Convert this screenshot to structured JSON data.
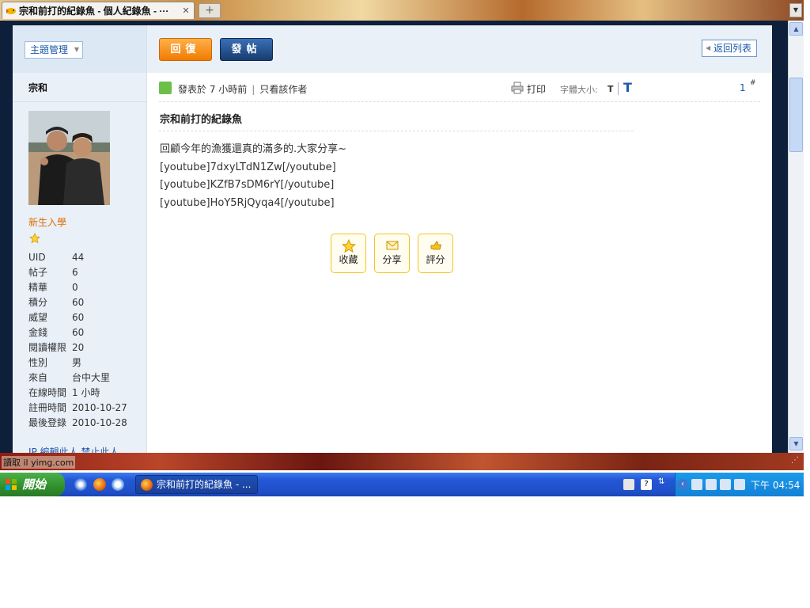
{
  "browser": {
    "tab_title": "宗和前打的紀錄魚 - 個人紀錄魚 - ···",
    "new_tab_symbol": "+",
    "status_text": "讀取 il yimg.com"
  },
  "toolbar": {
    "topic_management": "主題管理",
    "reply_label": "回復",
    "post_label": "發帖",
    "back_to_list": "返回列表"
  },
  "author": {
    "name": "宗和",
    "user_group": "新生入學",
    "stats": [
      {
        "label": "UID",
        "value": "44"
      },
      {
        "label": "帖子",
        "value": "6"
      },
      {
        "label": "精華",
        "value": "0"
      },
      {
        "label": "積分",
        "value": "60"
      },
      {
        "label": "威望",
        "value": "60"
      },
      {
        "label": "金錢",
        "value": "60"
      },
      {
        "label": "閱讀權限",
        "value": "20"
      },
      {
        "label": "性別",
        "value": "男"
      },
      {
        "label": "來自",
        "value": "台中大里"
      },
      {
        "label": "在線時間",
        "value": "1 小時"
      },
      {
        "label": "註冊時間",
        "value": "2010-10-27"
      },
      {
        "label": "最後登錄",
        "value": "2010-10-28"
      }
    ],
    "links": "IP   編輯此人   禁止此人"
  },
  "post": {
    "posted_at": "發表於 7 小時前",
    "separator": "|",
    "only_author": "只看該作者",
    "print_label": "打印",
    "font_size_label": "字體大小:",
    "font_small": "T",
    "font_large": "T",
    "floor_number": "1",
    "floor_symbol": "#",
    "title": "宗和前打的紀錄魚",
    "lines": [
      "回顧今年的漁獲還真的滿多的.大家分享~",
      "[youtube]7dxyLTdN1Zw[/youtube]",
      "[youtube]KZfB7sDM6rY[/youtube]",
      "[youtube]HoY5RjQyqa4[/youtube]"
    ],
    "actions": {
      "favorite": "收藏",
      "share": "分享",
      "rate": "評分"
    }
  },
  "taskbar": {
    "start_label": "開始",
    "window_button": "宗和前打的紀錄魚 - ...",
    "clock": "下午 04:54"
  }
}
